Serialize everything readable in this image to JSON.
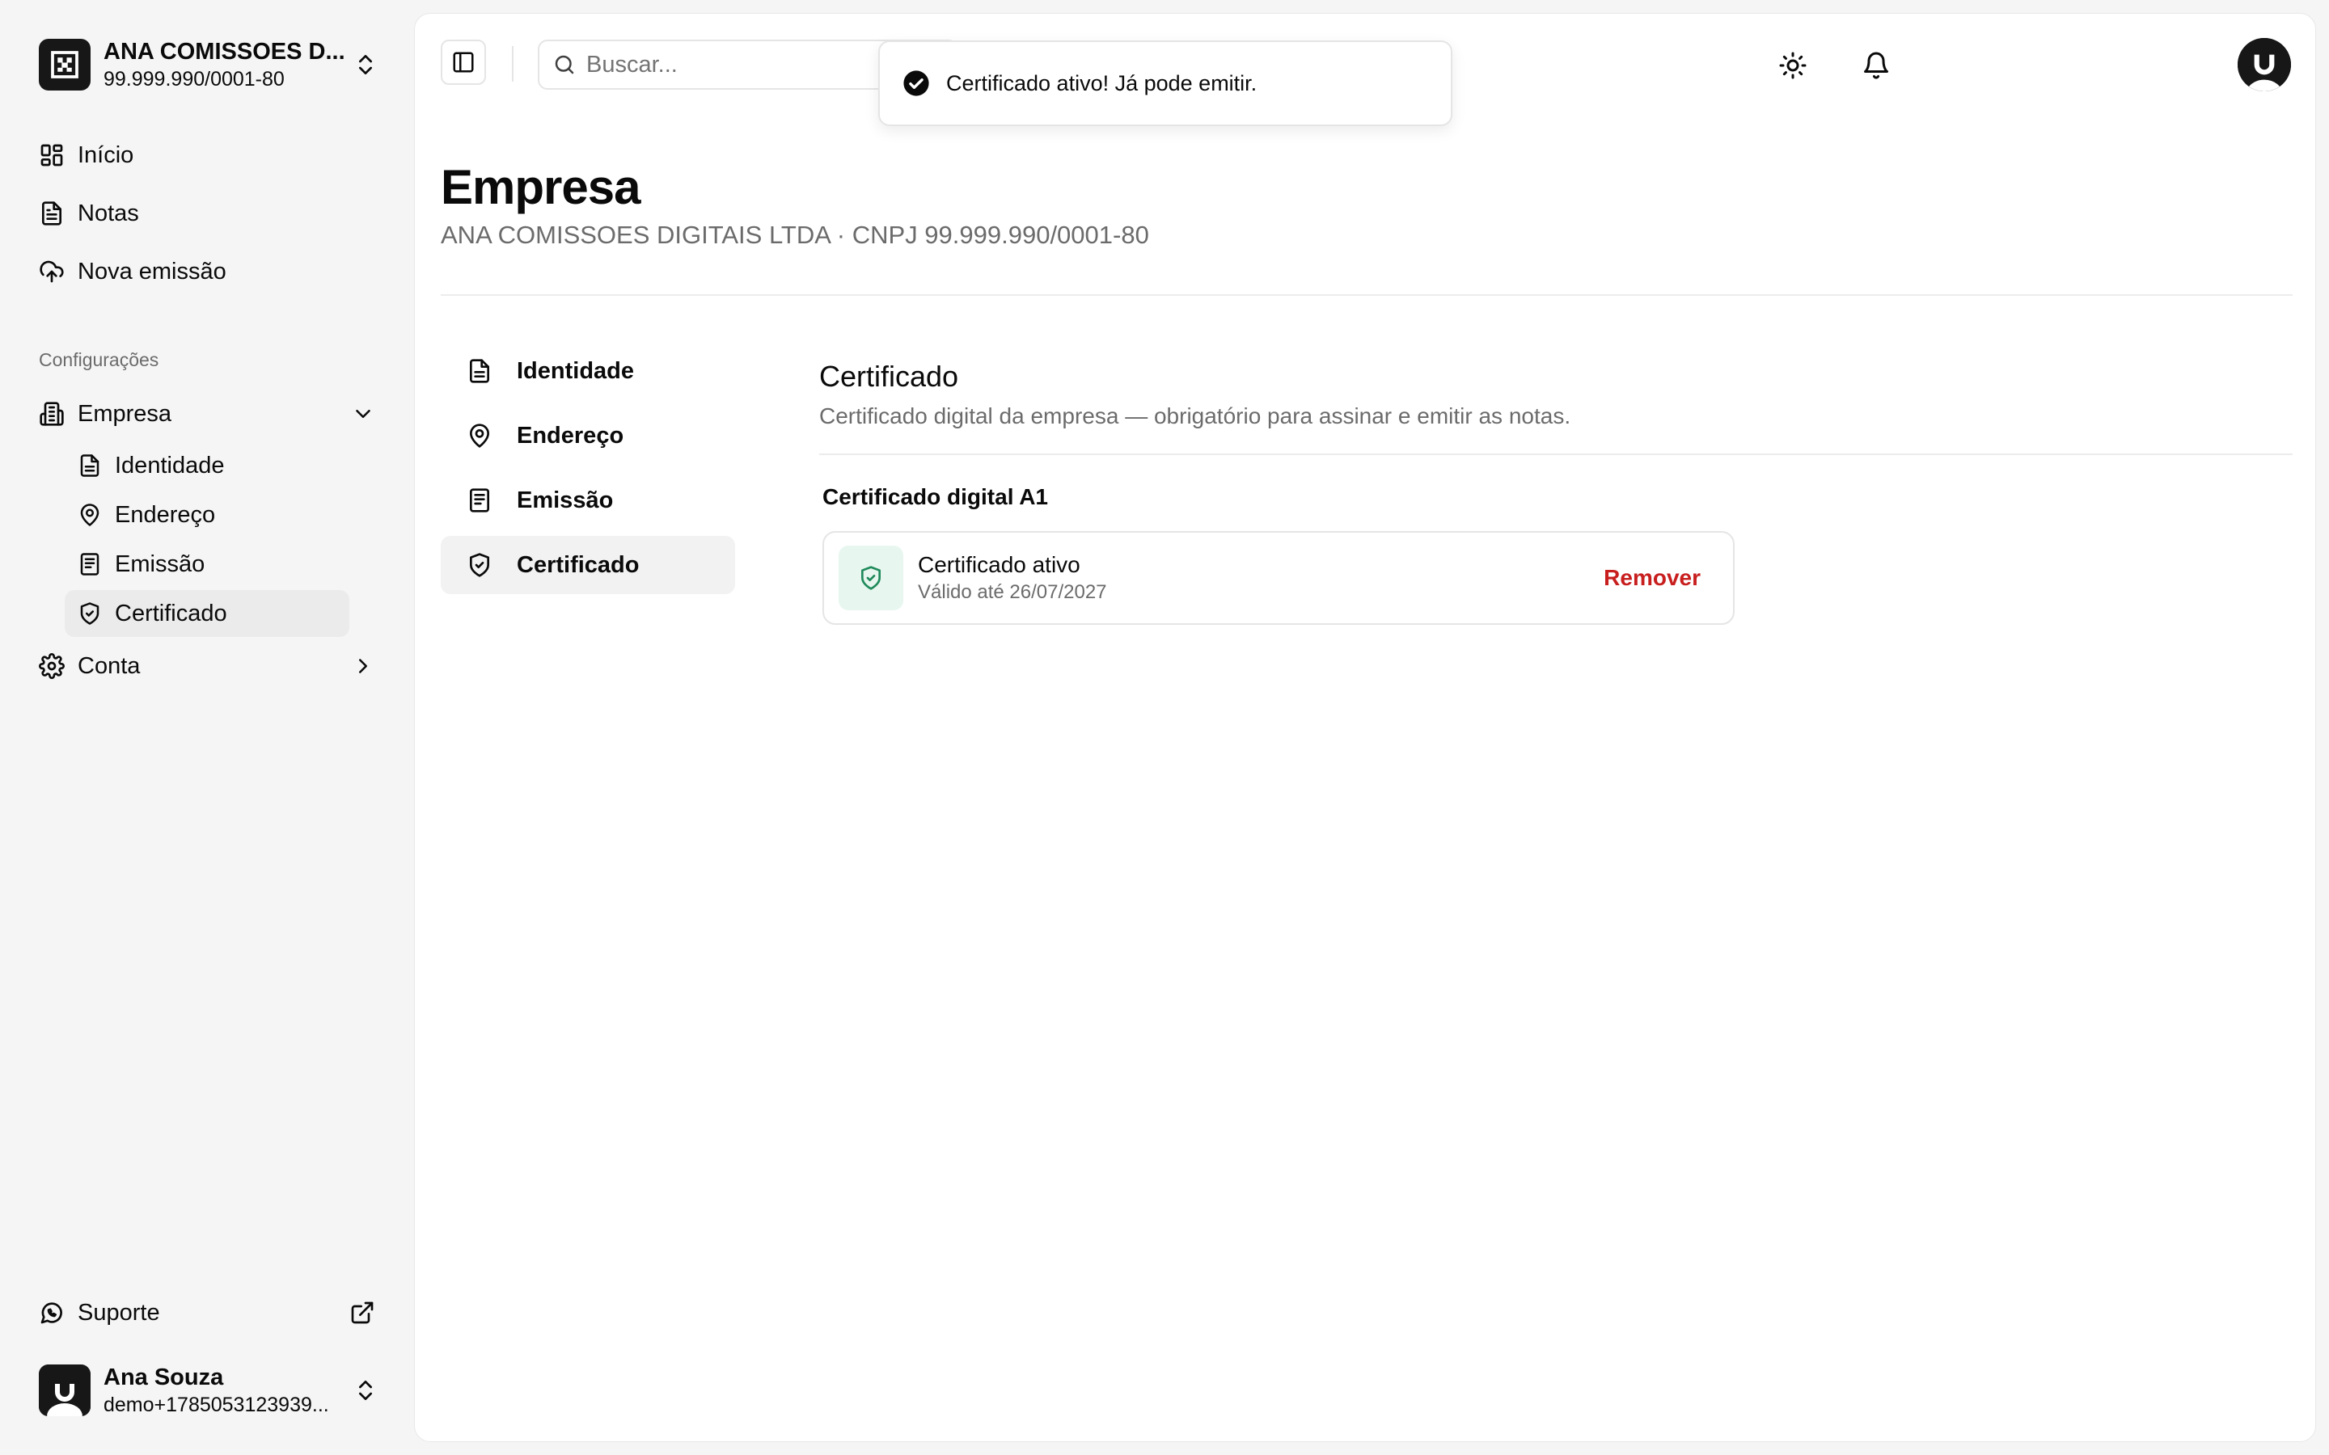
{
  "org": {
    "name": "ANA COMISSOES D...",
    "cnpj": "99.999.990/0001-80"
  },
  "nav": {
    "items": [
      {
        "label": "Início",
        "icon": "grid-icon"
      },
      {
        "label": "Notas",
        "icon": "file-text-icon"
      },
      {
        "label": "Nova emissão",
        "icon": "cloud-upload-icon"
      }
    ]
  },
  "config": {
    "section_label": "Configurações",
    "empresa": {
      "label": "Empresa",
      "children": [
        {
          "label": "Identidade",
          "icon": "file-text-icon"
        },
        {
          "label": "Endereço",
          "icon": "map-pin-icon"
        },
        {
          "label": "Emissão",
          "icon": "receipt-icon"
        },
        {
          "label": "Certificado",
          "icon": "shield-check-icon",
          "active": true
        }
      ]
    },
    "conta": {
      "label": "Conta"
    }
  },
  "support": {
    "label": "Suporte"
  },
  "user": {
    "name": "Ana Souza",
    "email": "demo+1785053123939..."
  },
  "topbar": {
    "search_placeholder": "Buscar..."
  },
  "toast": {
    "message": "Certificado ativo! Já pode emitir."
  },
  "page": {
    "title": "Empresa",
    "subtitle": "ANA COMISSOES DIGITAIS LTDA · CNPJ 99.999.990/0001-80"
  },
  "subnav": {
    "items": [
      {
        "label": "Identidade",
        "icon": "file-text-icon"
      },
      {
        "label": "Endereço",
        "icon": "map-pin-icon"
      },
      {
        "label": "Emissão",
        "icon": "receipt-icon"
      },
      {
        "label": "Certificado",
        "icon": "shield-check-icon",
        "active": true
      }
    ]
  },
  "certificate": {
    "title": "Certificado",
    "description": "Certificado digital da empresa — obrigatório para assinar e emitir as notas.",
    "type_label": "Certificado digital A1",
    "status": "Certificado ativo",
    "valid_until": "Válido até 26/07/2027",
    "remove_label": "Remover"
  },
  "colors": {
    "accent_dark": "#171717",
    "danger": "#c81e1e",
    "success_bg": "#e7f7ef",
    "success": "#1f8a5b"
  }
}
